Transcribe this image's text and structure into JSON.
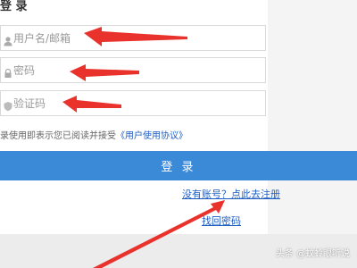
{
  "header": {
    "title": "登 录"
  },
  "form": {
    "username_placeholder": "用户名/邮箱",
    "password_placeholder": "密码",
    "captcha_placeholder": "验证码",
    "agreement_text": "录使用即表示您已阅读并接受",
    "agreement_link": "《用户使用协议》",
    "login_label": "登 录",
    "register_link": "没有账号？点此去注册",
    "forgot_link": "找回密码"
  },
  "watermark": "头条 @蚊蛉眼听说",
  "colors": {
    "primary": "#3b8ad8",
    "link": "#1e5ec2",
    "arrow": "#e8322b"
  },
  "icons": {
    "username": "user-icon",
    "password": "lock-icon",
    "captcha": "shield-icon"
  }
}
